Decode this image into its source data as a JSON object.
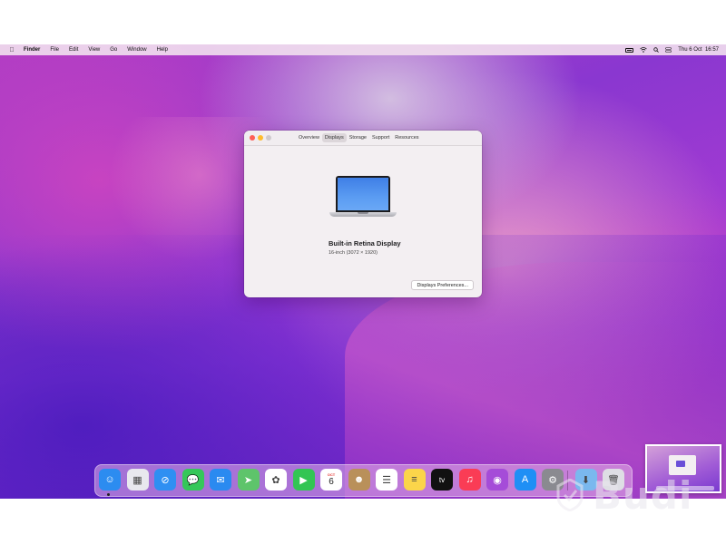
{
  "menubar": {
    "apple_icon": "apple-logo-icon",
    "items": [
      "Finder",
      "File",
      "Edit",
      "View",
      "Go",
      "Window",
      "Help"
    ],
    "clock": "Thu 6 Oct  16:57",
    "status_icons": [
      "battery-icon",
      "wifi-icon",
      "spotlight-search-icon",
      "control-center-icon"
    ]
  },
  "window": {
    "tabs": [
      "Overview",
      "Displays",
      "Storage",
      "Support",
      "Resources"
    ],
    "active_tab": "Displays",
    "display_name": "Built-in Retina Display",
    "display_detail": "16-inch (3072 × 1920)",
    "prefs_button": "Displays Preferences..."
  },
  "dock": {
    "apps": [
      {
        "name": "finder-icon",
        "glyph": "☺",
        "color": "#2c8cf0"
      },
      {
        "name": "launchpad-icon",
        "glyph": "▦",
        "color": "#e8e8ee"
      },
      {
        "name": "safari-icon",
        "glyph": "⊘",
        "color": "#2f8ff2"
      },
      {
        "name": "messages-icon",
        "glyph": "💬",
        "color": "#35c759"
      },
      {
        "name": "mail-icon",
        "glyph": "✉",
        "color": "#2a8af0"
      },
      {
        "name": "maps-icon",
        "glyph": "➤",
        "color": "#5ec46b"
      },
      {
        "name": "photos-icon",
        "glyph": "✿",
        "color": "#ffffff"
      },
      {
        "name": "facetime-icon",
        "glyph": "▶",
        "color": "#32c553"
      },
      {
        "name": "calendar-icon",
        "glyph": "6",
        "color": "#ffffff",
        "month": "OCT"
      },
      {
        "name": "contacts-icon",
        "glyph": "☻",
        "color": "#b9905a"
      },
      {
        "name": "reminders-icon",
        "glyph": "☰",
        "color": "#ffffff"
      },
      {
        "name": "notes-icon",
        "glyph": "≡",
        "color": "#fbd54a"
      },
      {
        "name": "apple-tv-icon",
        "glyph": "tv",
        "color": "#111111"
      },
      {
        "name": "music-icon",
        "glyph": "♫",
        "color": "#fa3c55"
      },
      {
        "name": "podcasts-icon",
        "glyph": "◉",
        "color": "#a54cd8"
      },
      {
        "name": "app-store-icon",
        "glyph": "A",
        "color": "#1f8ff5"
      },
      {
        "name": "system-preferences-icon",
        "glyph": "⚙",
        "color": "#8a8a90"
      },
      {
        "name": "downloads-folder-icon",
        "glyph": "⬇",
        "color": "#7ab8ee"
      },
      {
        "name": "trash-icon",
        "glyph": "🗑",
        "color": "#dedee4"
      }
    ]
  },
  "watermark": {
    "text": "Budi"
  }
}
